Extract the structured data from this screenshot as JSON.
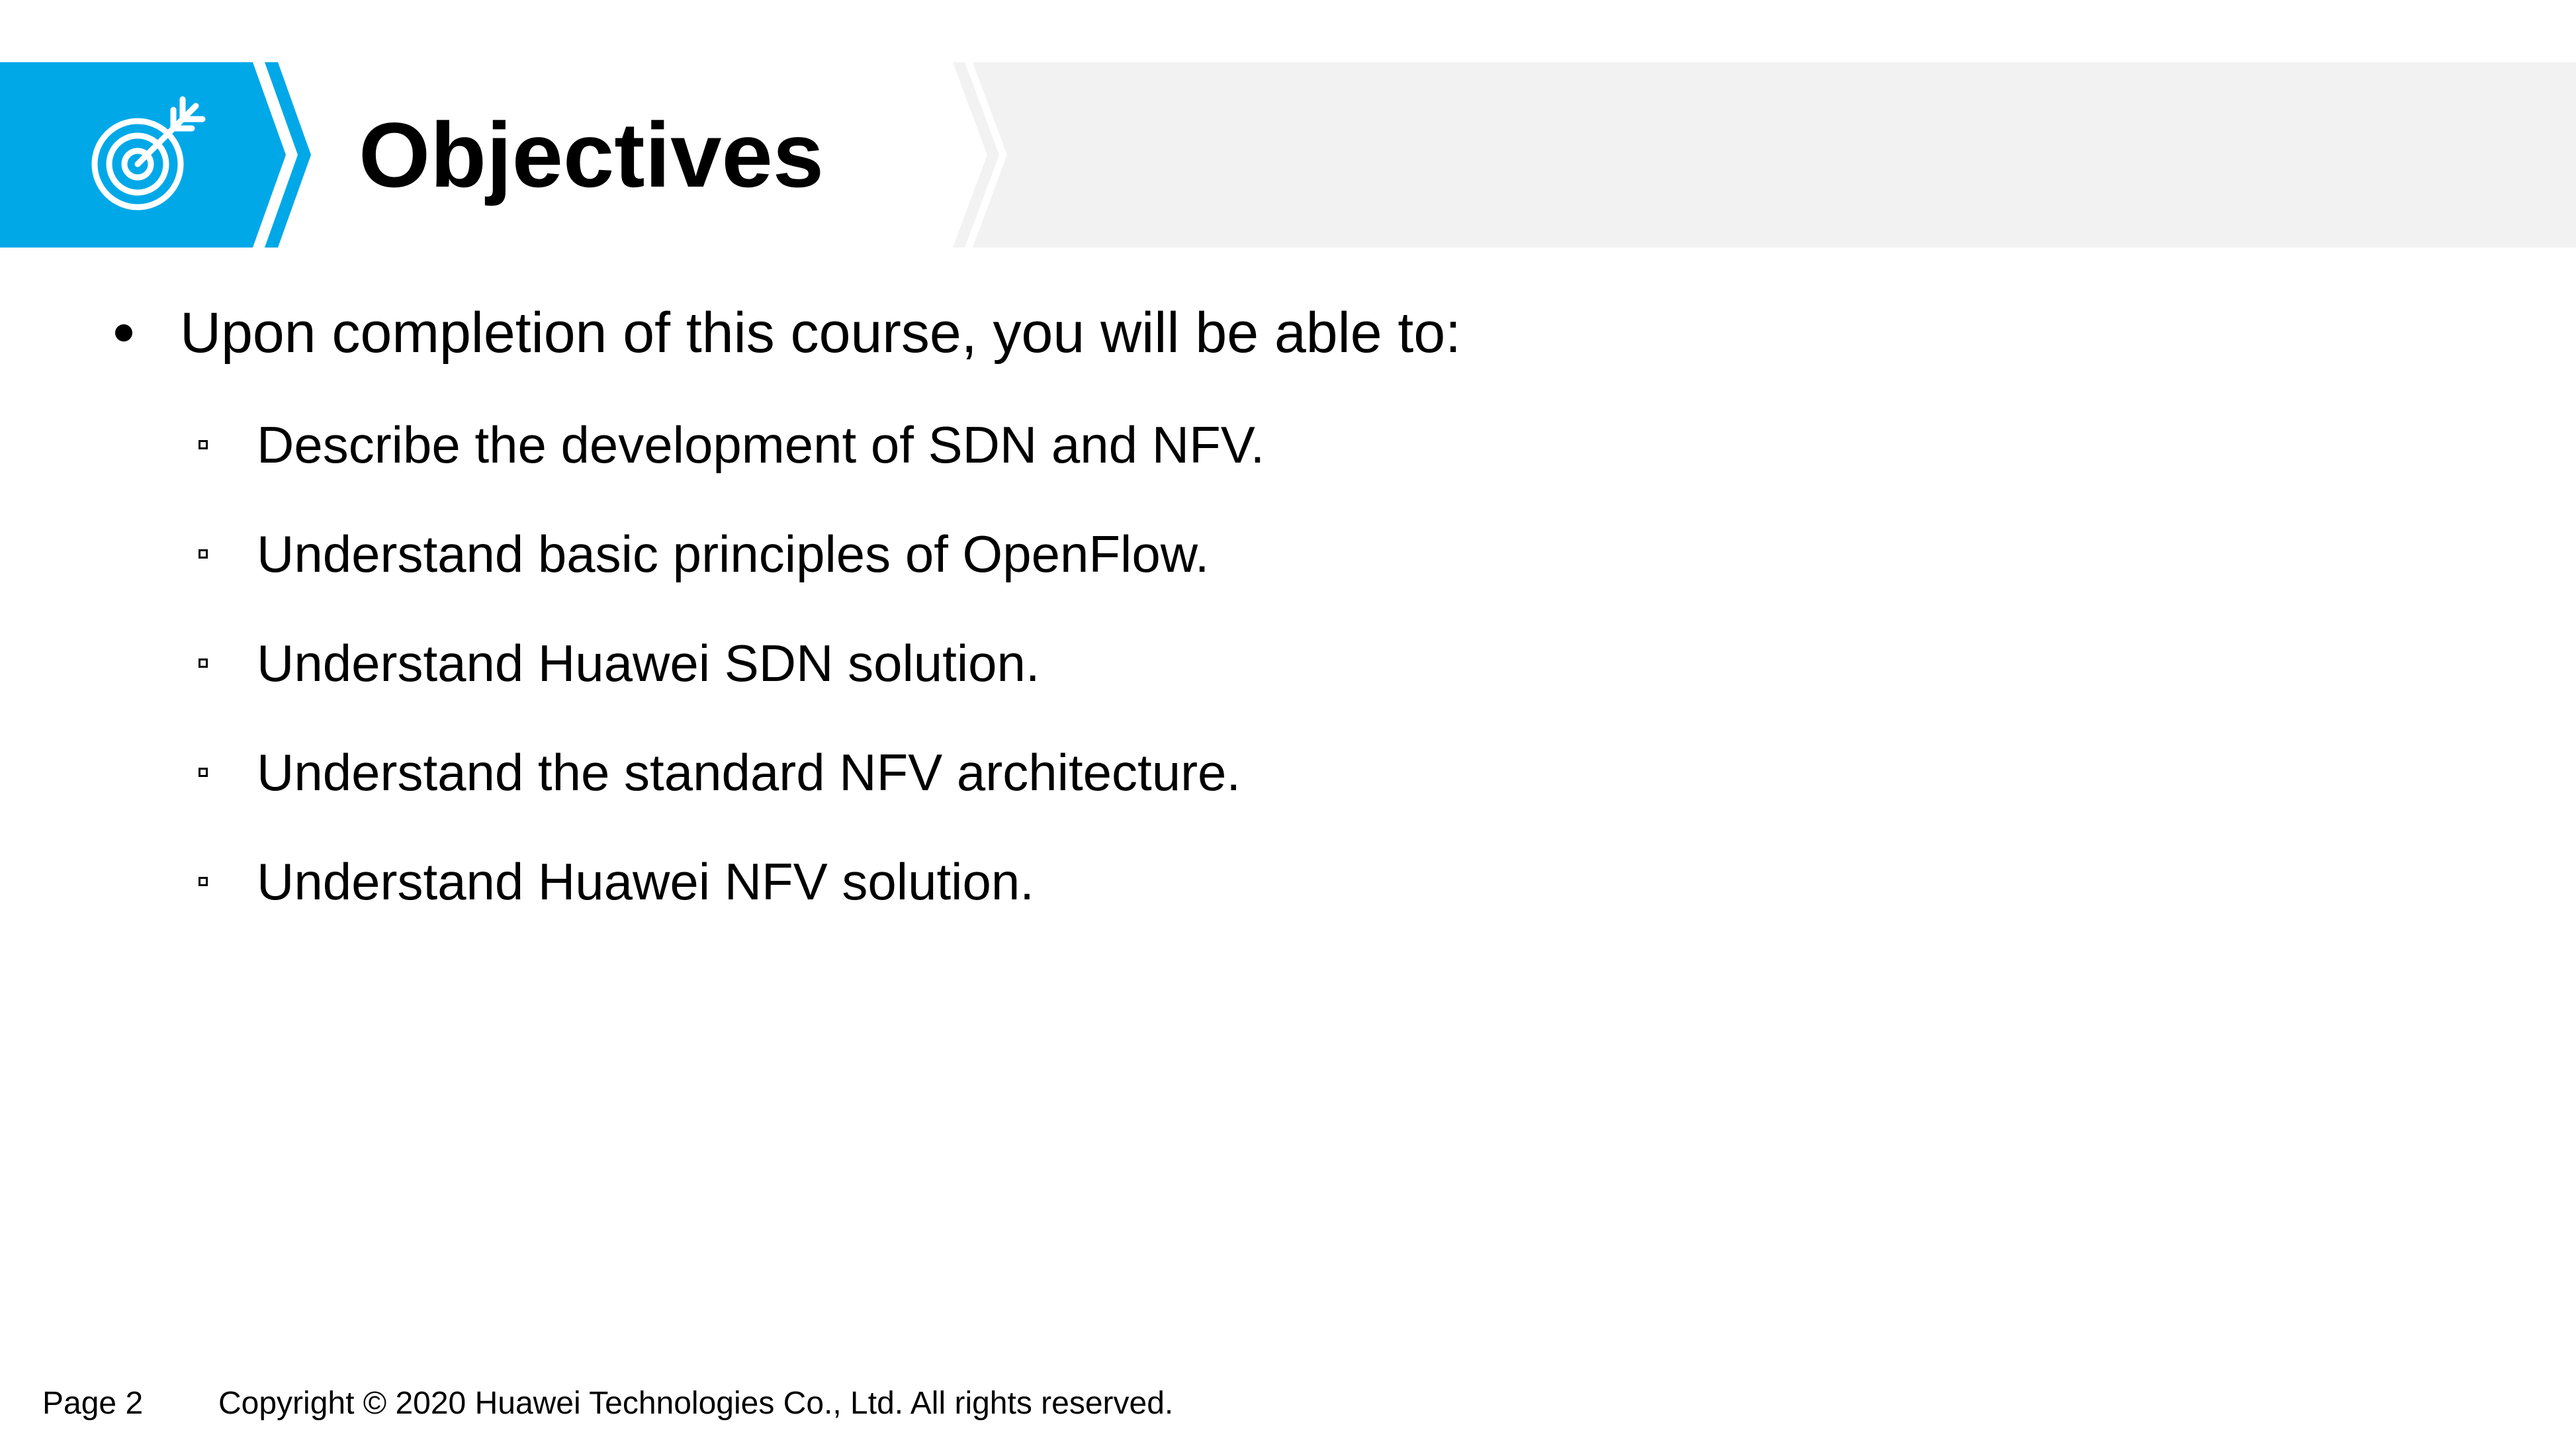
{
  "slide": {
    "title": "Objectives",
    "icon": "target-icon",
    "accent_color": "#00A8E8",
    "header_band_color": "#F2F2F2",
    "bullet": {
      "text": "Upon completion of this course, you will be able to:"
    },
    "items": [
      {
        "text": "Describe the development of SDN and NFV."
      },
      {
        "text": "Understand basic principles of OpenFlow."
      },
      {
        "text": "Understand Huawei SDN solution."
      },
      {
        "text": "Understand the standard NFV architecture."
      },
      {
        "text": "Understand Huawei NFV solution."
      }
    ]
  },
  "footer": {
    "page": "Page 2",
    "copyright": "Copyright © 2020 Huawei Technologies Co., Ltd. All rights reserved."
  }
}
